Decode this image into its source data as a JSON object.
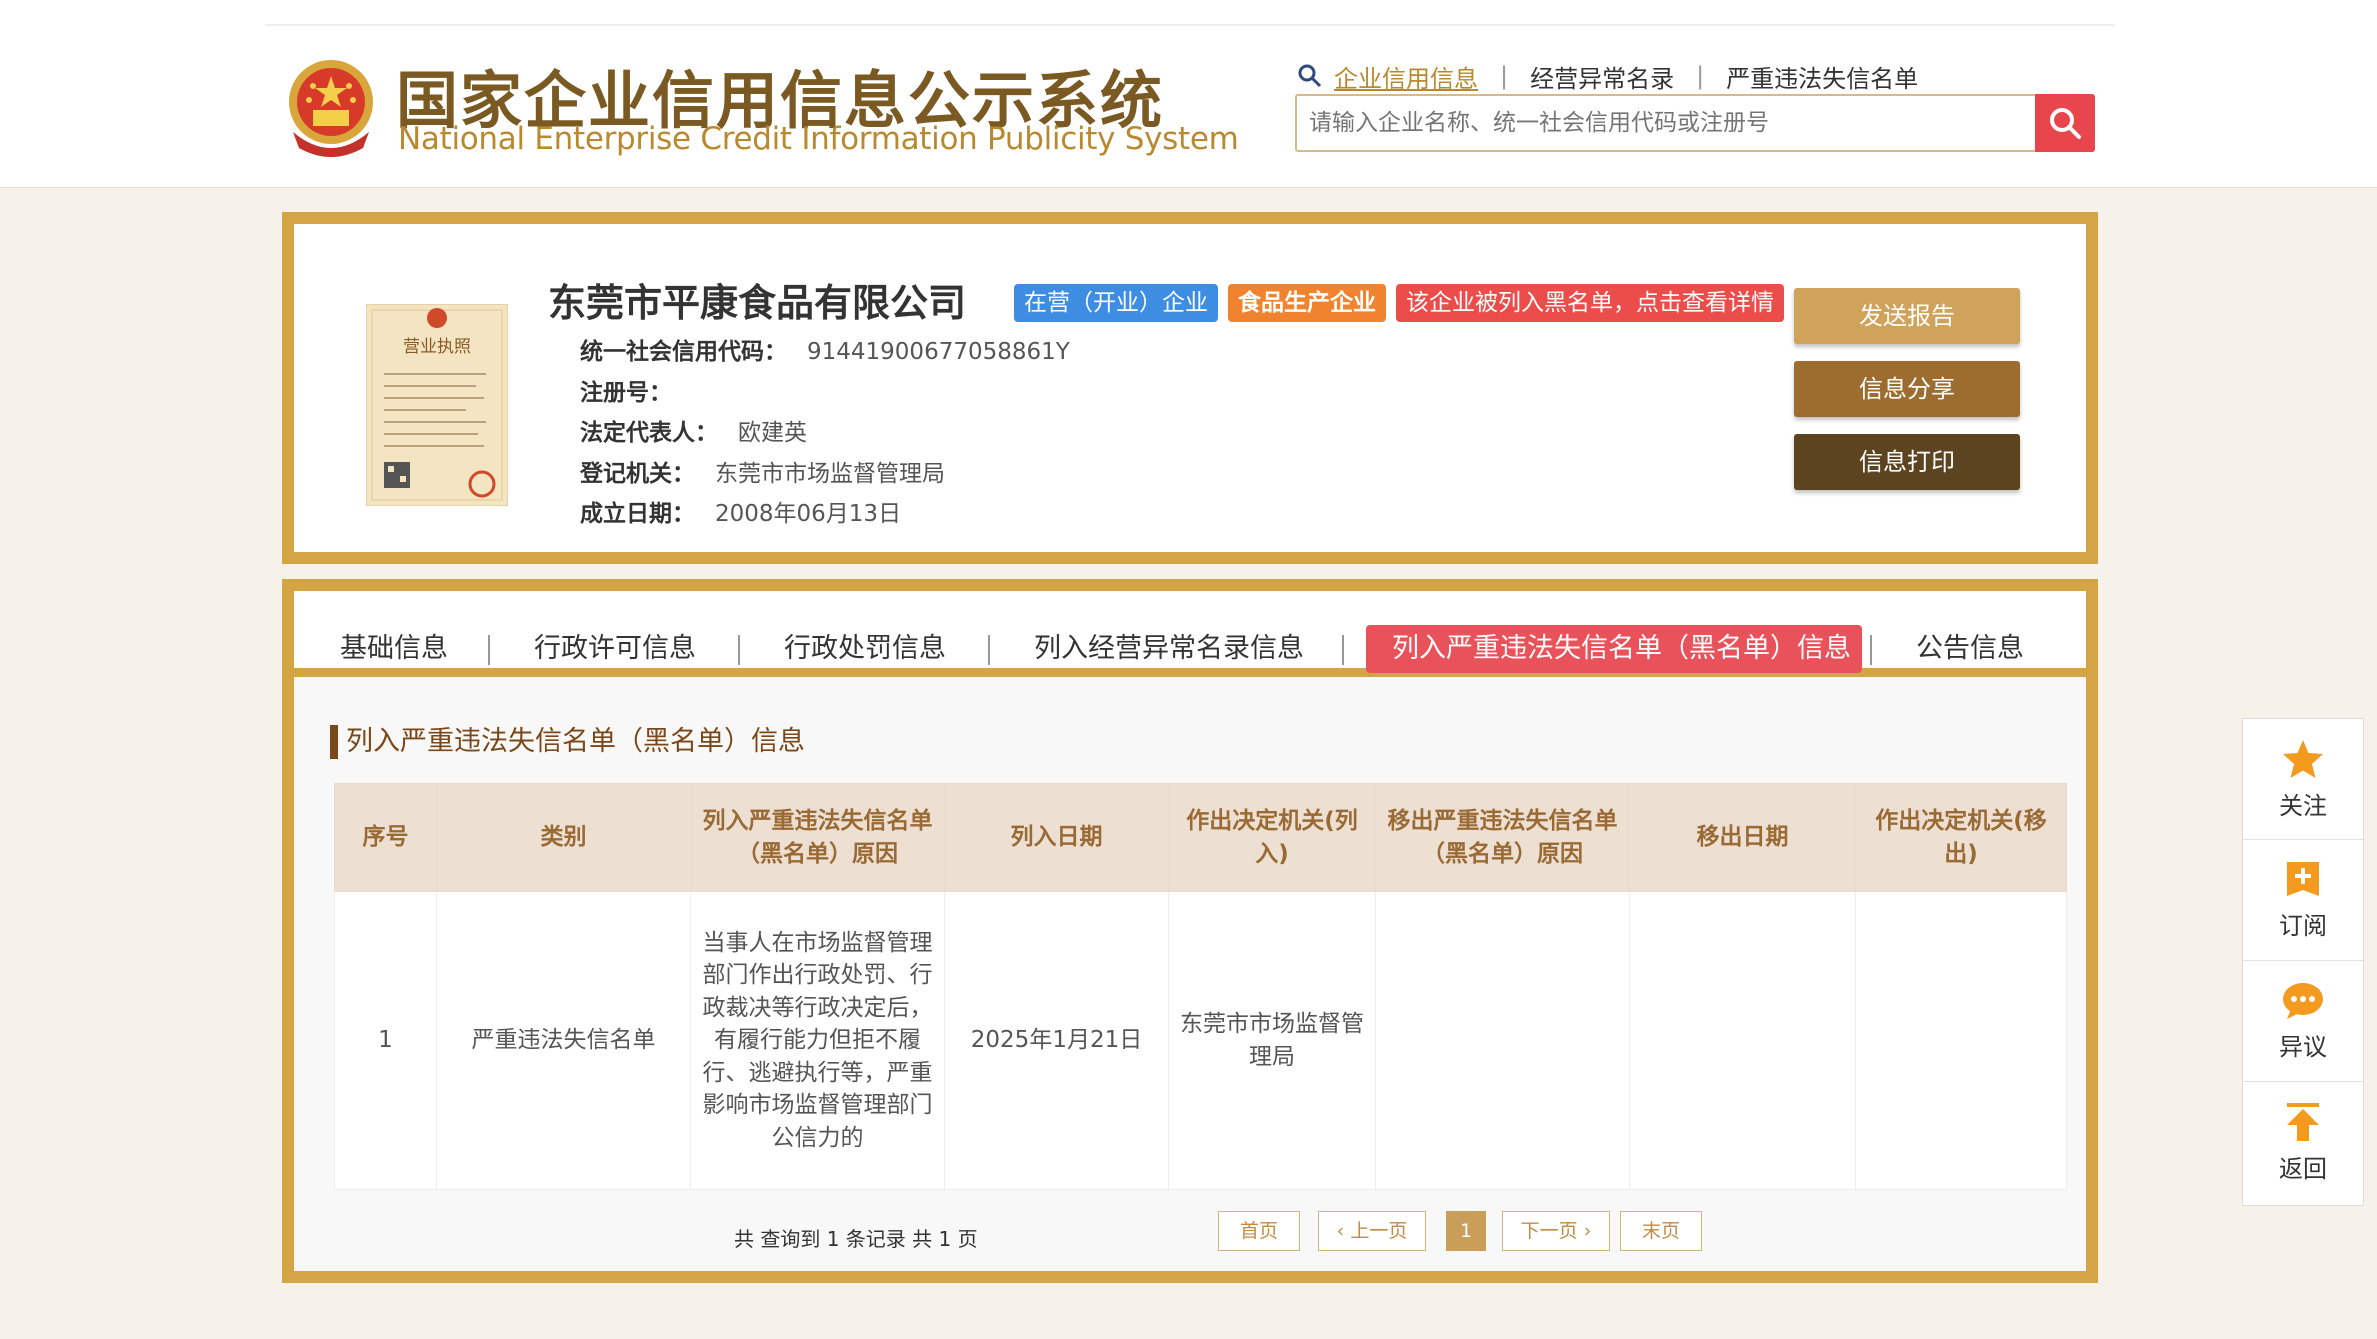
{
  "header": {
    "logo_cn": "国家企业信用信息公示系统",
    "logo_en": "National Enterprise Credit Information Publicity System",
    "nav": [
      {
        "label": "企业信用信息"
      },
      {
        "label": "经营异常名录"
      },
      {
        "label": "严重违法失信名单"
      }
    ],
    "search": {
      "placeholder": "请输入企业名称、统一社会信用代码或注册号"
    }
  },
  "company": {
    "name": "东莞市平康食品有限公司",
    "tags": {
      "status": "在营（开业）企业",
      "type": "食品生产企业",
      "warning": "该企业被列入黑名单，点击查看详情"
    },
    "fields": [
      {
        "key": "统一社会信用代码：",
        "value": "91441900677058861Y"
      },
      {
        "key": "注册号：",
        "value": ""
      },
      {
        "key": "法定代表人：",
        "value": "欧建英"
      },
      {
        "key": "登记机关：",
        "value": "东莞市市场监督管理局"
      },
      {
        "key": "成立日期：",
        "value": "2008年06月13日"
      }
    ],
    "license_title": "营业执照"
  },
  "actions": {
    "send_report": "发送报告",
    "share": "信息分享",
    "print": "信息打印"
  },
  "tabs": [
    {
      "label": "基础信息"
    },
    {
      "label": "行政许可信息"
    },
    {
      "label": "行政处罚信息"
    },
    {
      "label": "列入经营异常名录信息"
    },
    {
      "label": "列入严重违法失信名单（黑名单）信息"
    },
    {
      "label": "公告信息"
    }
  ],
  "section_title": "列入严重违法失信名单（黑名单）信息",
  "table": {
    "headers": [
      "序号",
      "类别",
      "列入严重违法失信名单（黑名单）原因",
      "列入日期",
      "作出决定机关(列入)",
      "移出严重违法失信名单（黑名单）原因",
      "移出日期",
      "作出决定机关(移出)"
    ],
    "rows": [
      [
        "1",
        "严重违法失信名单",
        "当事人在市场监督管理部门作出行政处罚、行政裁决等行政决定后，有履行能力但拒不履行、逃避执行等，严重影响市场监督管理部门公信力的",
        "2025年1月21日",
        "东莞市市场监督管理局",
        "",
        "",
        ""
      ]
    ]
  },
  "pagination": {
    "summary": "共 查询到 1 条记录 共 1 页",
    "first": "首页",
    "prev": "上一页",
    "current": "1",
    "next": "下一页",
    "last": "末页"
  },
  "sidebar": [
    {
      "label": "关注",
      "icon": "star-icon"
    },
    {
      "label": "订阅",
      "icon": "subscribe-icon"
    },
    {
      "label": "异议",
      "icon": "comment-icon"
    },
    {
      "label": "返回",
      "icon": "back-top-icon"
    }
  ],
  "colors": {
    "brand_gold": "#d4a445",
    "accent_red": "#e9525a",
    "tag_blue": "#3d8ee2",
    "tag_orange": "#ef8330"
  }
}
